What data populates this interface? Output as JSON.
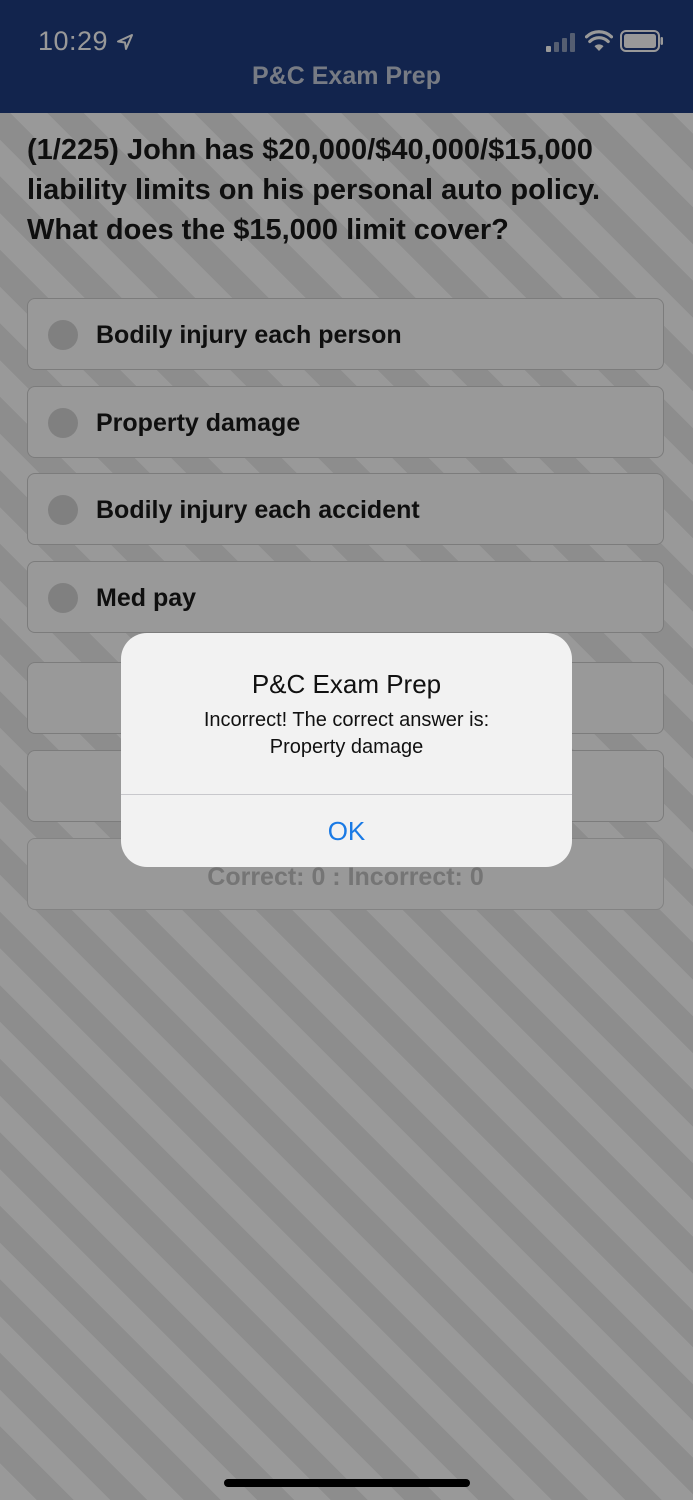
{
  "status_bar": {
    "time": "10:29"
  },
  "nav": {
    "title": "P&C Exam Prep"
  },
  "question": {
    "text": "(1/225) John has $20,000/$40,000/$15,000 liability limits on his personal auto policy. What does the $15,000 limit cover?"
  },
  "options": [
    {
      "label": "Bodily injury each person"
    },
    {
      "label": "Property damage"
    },
    {
      "label": "Bodily injury each accident"
    },
    {
      "label": "Med pay"
    }
  ],
  "score": {
    "text": "Correct: 0 : Incorrect: 0"
  },
  "alert": {
    "title": "P&C Exam Prep",
    "message_line1": "Incorrect! The correct answer is:",
    "message_line2": "Property damage",
    "ok_label": "OK"
  },
  "icons": {
    "location": "location-arrow-icon",
    "signal": "cellular-signal-icon",
    "wifi": "wifi-icon",
    "battery": "battery-icon"
  },
  "colors": {
    "nav_background": "#1f3d80",
    "alert_button": "#1a7ae5"
  }
}
